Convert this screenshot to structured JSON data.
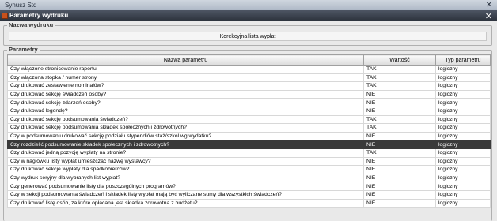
{
  "app": {
    "title": "Synusz Std"
  },
  "dialog": {
    "title": "Parametry wydruku"
  },
  "print_name_group": {
    "legend": "Nazwa wydruku",
    "value": "Korekcyjna lista wypłat"
  },
  "params_group": {
    "legend": "Parametry",
    "columns": [
      "Nazwa parametru",
      "Wartość",
      "Typ parametru"
    ],
    "rows": [
      {
        "name": "Czy włączone stronicowanie raportu",
        "value": "TAK",
        "type": "logiczny"
      },
      {
        "name": "Czy włączona stopka / numer strony",
        "value": "TAK",
        "type": "logiczny"
      },
      {
        "name": "Czy drukować zestawienie nominałów?",
        "value": "TAK",
        "type": "logiczny"
      },
      {
        "name": "Czy drukować sekcję świadczeń osoby?",
        "value": "NIE",
        "type": "logiczny"
      },
      {
        "name": "Czy drukować sekcję zdarzeń osoby?",
        "value": "NIE",
        "type": "logiczny"
      },
      {
        "name": "Czy drukować legendę?",
        "value": "NIE",
        "type": "logiczny"
      },
      {
        "name": "Czy drukować sekcję podsumowania świadczeń?",
        "value": "TAK",
        "type": "logiczny"
      },
      {
        "name": "Czy drukować sekcję podsumowania składek społecznych i zdrowotnych?",
        "value": "TAK",
        "type": "logiczny"
      },
      {
        "name": "Czy w podsumowaniu drukować sekcję podziału stypendiów staż/szkol wg wydatku?",
        "value": "NIE",
        "type": "logiczny"
      },
      {
        "name": "Czy rozdzielić podsumowanie składek społecznych i zdrowotnych?",
        "value": "NIE",
        "type": "logiczny",
        "selected": true
      },
      {
        "name": "Czy drukować jedną pozycję wypłaty na stronie?",
        "value": "TAK",
        "type": "logiczny"
      },
      {
        "name": "Czy w nagłówku listy wypłat umieszczać nazwę wystawcy?",
        "value": "NIE",
        "type": "logiczny"
      },
      {
        "name": "Czy drukować sekcje wypłaty dla spadkobierców?",
        "value": "NIE",
        "type": "logiczny"
      },
      {
        "name": "Czy wydruk seryjny dla wybranych list wypłat?",
        "value": "NIE",
        "type": "logiczny"
      },
      {
        "name": "Czy generować podsumowanie listy dla poszczególnych programów?",
        "value": "NIE",
        "type": "logiczny"
      },
      {
        "name": "Czy w sekcji podsumowania świadczeń i składek listy wypłat mają być wyliczane sumy dla wszystkich świadczeń?",
        "value": "NIE",
        "type": "logiczny"
      },
      {
        "name": "Czy drukować listę osób, za które opłacana jest składka zdrowotna z budżetu?",
        "value": "NIE",
        "type": "logiczny"
      }
    ]
  }
}
